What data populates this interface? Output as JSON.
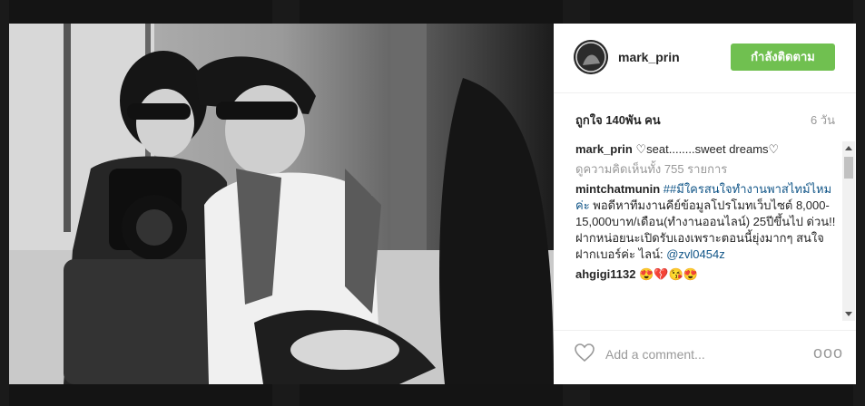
{
  "post": {
    "username": "mark_prin",
    "follow_label": "กำลังติดตาม",
    "likes": "ถูกใจ 140พัน คน",
    "time": "6 วัน",
    "caption_text": "seat........sweet dreams",
    "view_all": "ดูความคิดเห็นทั้ง 755 รายการ",
    "comments": [
      {
        "user": "mintchatmunin",
        "link": "##มีใครสนใจทำงานพาสไทม์ไหมค่ะ",
        "text": " พอดีหาทีมงานคีย์ข้อมูลโปรโมทเว็บไซต์ 8,000-15,000บาท/เดือน(ทำงานออนไลน์) 25ปีขึ้นไป ด่วน!! ฝากหน่อยนะเปิดรับเองเพราะตอนนี้ยุ่งมากๆ สนใจฝากเบอร์ค่ะ ไลน์: ",
        "mention": "@zvl0454z"
      },
      {
        "user": "ahgigi1132",
        "text": "😍💔😘😍"
      }
    ],
    "add_comment_placeholder": "Add a comment...",
    "more_label": "ooo"
  },
  "colors": {
    "follow_bg": "#70c050",
    "link": "#125688"
  }
}
